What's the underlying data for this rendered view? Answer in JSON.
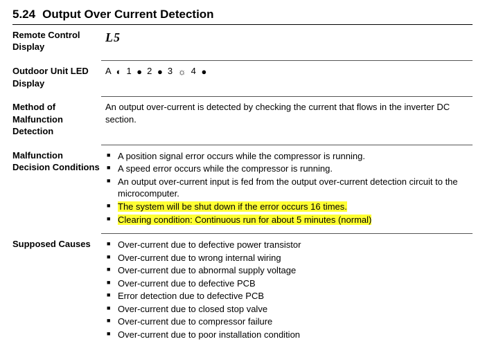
{
  "heading": {
    "number": "5.24",
    "title": "Output Over Current Detection"
  },
  "remote": {
    "label": "Remote Control Display",
    "code": "L5"
  },
  "led": {
    "label": "Outdoor Unit LED Display",
    "items": [
      {
        "n": "A",
        "sym": "flash"
      },
      {
        "n": "1",
        "sym": "on"
      },
      {
        "n": "2",
        "sym": "on"
      },
      {
        "n": "3",
        "sym": "off"
      },
      {
        "n": "4",
        "sym": "on"
      }
    ]
  },
  "method": {
    "label": "Method of Malfunction Detection",
    "text": "An output over-current is detected by checking the current that flows in the inverter DC section."
  },
  "decision": {
    "label": "Malfunction Decision Conditions",
    "items": [
      {
        "text": "A position signal error occurs while the compressor is running.",
        "highlight": false
      },
      {
        "text": "A speed error occurs while the compressor is running.",
        "highlight": false
      },
      {
        "text": "An output over-current input is fed from the output over-current detection circuit to the microcomputer.",
        "highlight": false
      },
      {
        "text": "The system will be shut down if the error occurs 16 times.",
        "highlight": true
      },
      {
        "text": "Clearing condition: Continuous run for about 5 minutes (normal)",
        "highlight": true
      }
    ]
  },
  "causes": {
    "label": "Supposed Causes",
    "items": [
      "Over-current due to defective power transistor",
      "Over-current due to wrong internal wiring",
      "Over-current due to abnormal supply voltage",
      "Over-current due to defective PCB",
      "Error detection due to defective PCB",
      "Over-current due to closed stop valve",
      "Over-current due to compressor failure",
      "Over-current due to poor installation condition"
    ]
  }
}
